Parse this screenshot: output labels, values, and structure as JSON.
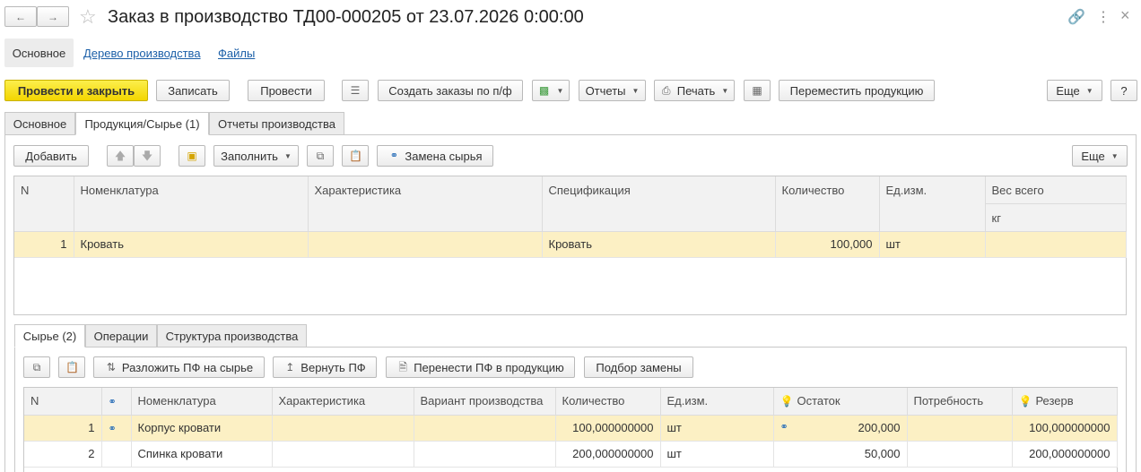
{
  "window": {
    "title": "Заказ в производство ТД00-000205 от 23.07.2026 0:00:00"
  },
  "nav_tabs": [
    "Основное",
    "Дерево производства",
    "Файлы"
  ],
  "toolbar": {
    "post_close": "Провести и закрыть",
    "save": "Записать",
    "post": "Провести",
    "create_orders": "Создать заказы по п/ф",
    "reports": "Отчеты",
    "print": "Печать",
    "move_product": "Переместить продукцию",
    "more": "Еще",
    "help": "?"
  },
  "form_tabs": [
    "Основное",
    "Продукция/Сырье (1)",
    "Отчеты производства"
  ],
  "product_toolbar": {
    "add": "Добавить",
    "fill": "Заполнить",
    "replace": "Замена сырья",
    "more": "Еще"
  },
  "product_table": {
    "headers": [
      "N",
      "Номенклатура",
      "Характеристика",
      "Спецификация",
      "Количество",
      "Ед.изм.",
      "Вес всего"
    ],
    "weight_unit": "кг",
    "rows": [
      {
        "n": "1",
        "item": "Кровать",
        "char": "",
        "spec": "Кровать",
        "qty": "100,000",
        "unit": "шт",
        "weight": ""
      }
    ]
  },
  "sub_tabs": [
    "Сырье (2)",
    "Операции",
    "Структура производства"
  ],
  "raw_toolbar": {
    "split": "Разложить ПФ на сырье",
    "return": "Вернуть ПФ",
    "transfer": "Перенести ПФ в продукцию",
    "pick": "Подбор замены"
  },
  "raw_table": {
    "headers": [
      "N",
      "",
      "Номенклатура",
      "Характеристика",
      "Вариант производства",
      "Количество",
      "Ед.изм.",
      "Остаток",
      "Потребность",
      "Резерв"
    ],
    "rows": [
      {
        "n": "1",
        "item": "Корпус кровати",
        "char": "",
        "variant": "",
        "qty": "100,000000000",
        "unit": "шт",
        "stock": "200,000",
        "need": "",
        "reserve": "100,000000000"
      },
      {
        "n": "2",
        "item": "Спинка кровати",
        "char": "",
        "variant": "",
        "qty": "200,000000000",
        "unit": "шт",
        "stock": "50,000",
        "need": "",
        "reserve": "200,000000000"
      }
    ]
  },
  "colors": {
    "accent": "#f3d500",
    "selected_row": "#fcf0c4",
    "link": "#1b5fa8"
  },
  "icons": [
    "back-arrow-icon",
    "forward-arrow-icon",
    "star-icon",
    "link-icon",
    "more-vertical-icon",
    "close-icon"
  ]
}
